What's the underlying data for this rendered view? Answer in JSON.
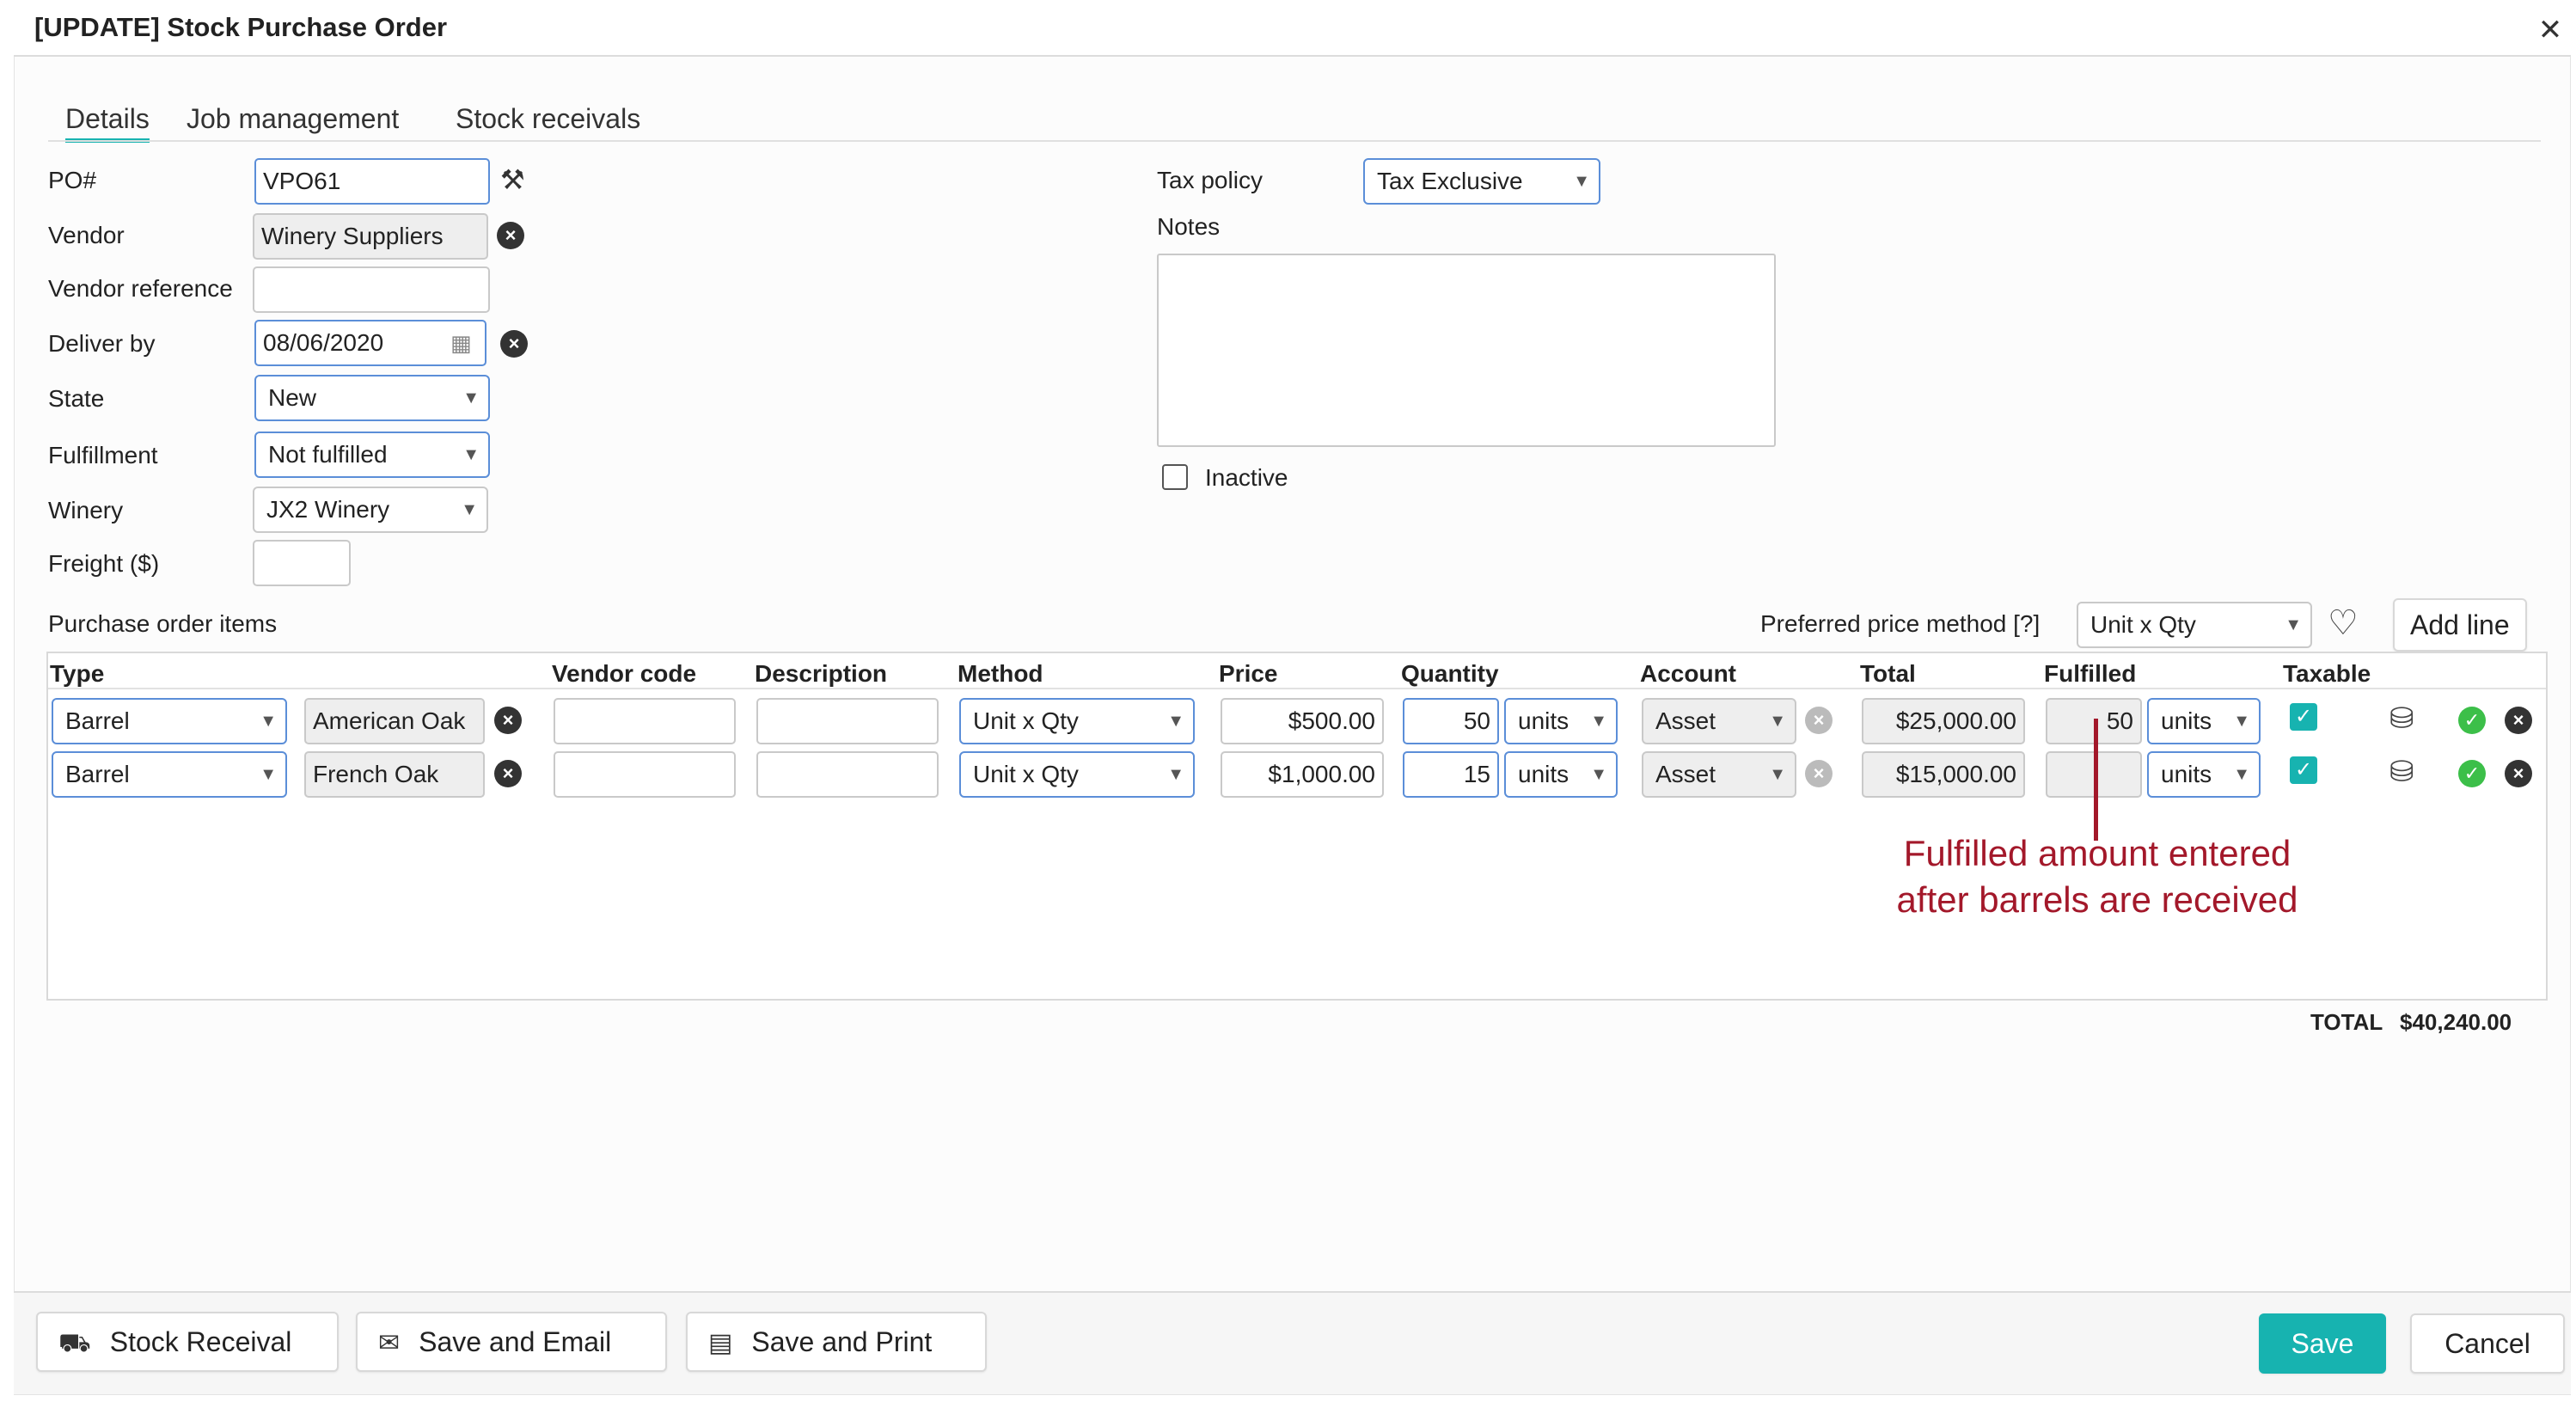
{
  "dialog": {
    "title": "[UPDATE] Stock Purchase Order",
    "close_icon": "close-icon"
  },
  "tabs": [
    {
      "label": "Details",
      "active": true
    },
    {
      "label": "Job management"
    },
    {
      "label": "Stock receivals"
    }
  ],
  "form": {
    "po_label": "PO#",
    "po_value": "VPO61",
    "vendor_label": "Vendor",
    "vendor_value": "Winery Suppliers",
    "vendor_ref_label": "Vendor reference",
    "vendor_ref_value": "",
    "deliver_label": "Deliver by",
    "deliver_value": "08/06/2020",
    "state_label": "State",
    "state_value": "New",
    "fulfillment_label": "Fulfillment",
    "fulfillment_value": "Not fulfilled",
    "winery_label": "Winery",
    "winery_value": "JX2 Winery",
    "freight_label": "Freight ($)",
    "freight_value": "",
    "tax_label": "Tax policy",
    "tax_value": "Tax Exclusive",
    "notes_label": "Notes",
    "notes_value": "",
    "inactive_label": "Inactive"
  },
  "items": {
    "section_label": "Purchase order items",
    "preferred_label": "Preferred price method [?]",
    "preferred_value": "Unit x Qty",
    "add_line_label": "Add line",
    "headers": [
      "Type",
      "Vendor code",
      "Description",
      "Method",
      "Price",
      "Quantity",
      "Account",
      "Total",
      "Fulfilled",
      "Taxable"
    ],
    "rows": [
      {
        "type": "Barrel",
        "item": "American Oak",
        "vendor_code": "",
        "description": "",
        "method": "Unit x Qty",
        "price": "$500.00",
        "qty": "50",
        "qty_unit": "units",
        "account": "Asset",
        "total": "$25,000.00",
        "fulfilled": "50",
        "fulfilled_unit": "units",
        "taxable": true
      },
      {
        "type": "Barrel",
        "item": "French Oak",
        "vendor_code": "",
        "description": "",
        "method": "Unit x Qty",
        "price": "$1,000.00",
        "qty": "15",
        "qty_unit": "units",
        "account": "Asset",
        "total": "$15,000.00",
        "fulfilled": "",
        "fulfilled_unit": "units",
        "taxable": true
      }
    ],
    "total_label": "TOTAL",
    "total_value": "$40,240.00"
  },
  "annotation": {
    "line1": "Fulfilled amount entered",
    "line2": "after barrels are received",
    "color": "#a3182a"
  },
  "footer": {
    "stock_receival": "Stock Receival",
    "save_email": "Save and Email",
    "save_print": "Save and Print",
    "save": "Save",
    "cancel": "Cancel"
  },
  "colors": {
    "accent": "#17b3b0",
    "input_border": "#5b8ed8"
  }
}
